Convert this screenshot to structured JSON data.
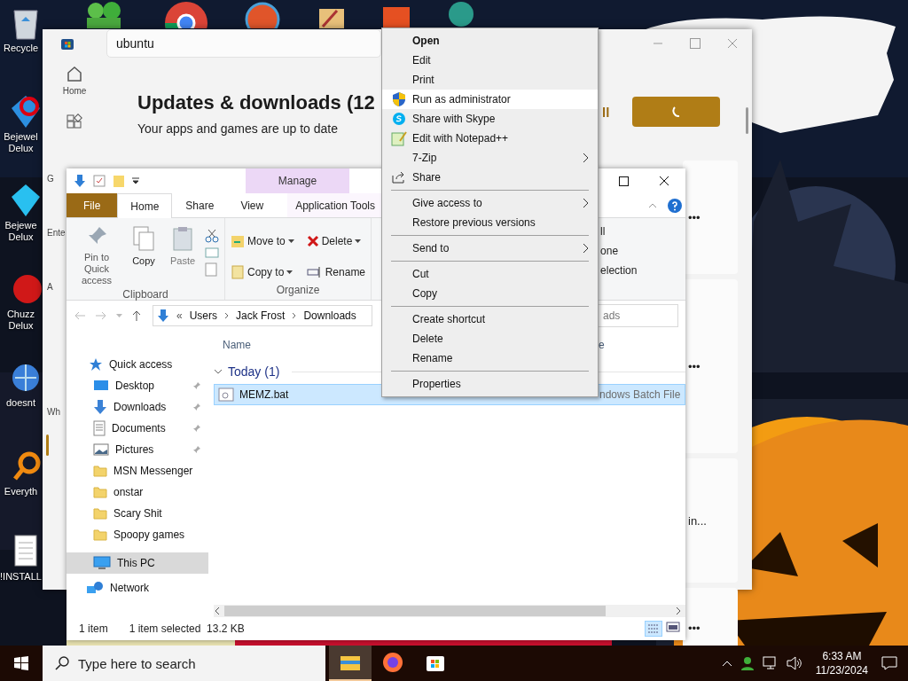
{
  "desktop": {
    "icons": [
      {
        "label": "Recycle"
      },
      {
        "label": "Bejewel Delux"
      },
      {
        "label": "Bejewe Delux"
      },
      {
        "label": "Chuzz Delux"
      },
      {
        "label": "doesnt"
      },
      {
        "label": "Everyth"
      },
      {
        "label": "!INSTALL"
      }
    ]
  },
  "store_window": {
    "search": {
      "value": "ubuntu"
    },
    "nav": [
      {
        "label": "Home"
      }
    ],
    "nav_fragments": [
      "G",
      "Ente",
      "A",
      "Wh"
    ],
    "heading": "Updates & downloads (12",
    "subtitle": "Your apps and games are up to date",
    "update_all_fragment": "ll",
    "card_fragments": [
      "•••",
      "•••",
      "in...",
      "•••"
    ]
  },
  "explorer_window": {
    "manage_label": "Manage",
    "tabs": [
      {
        "label": "File",
        "kind": "file",
        "selected": false
      },
      {
        "label": "Home",
        "kind": "tab",
        "selected": true
      },
      {
        "label": "Share",
        "kind": "tab",
        "selected": false
      },
      {
        "label": "View",
        "kind": "tab",
        "selected": false
      },
      {
        "label": "Application Tools",
        "kind": "tab",
        "selected": false
      }
    ],
    "ribbon": {
      "clipboard": {
        "label": "Clipboard",
        "buttons": [
          "Pin to Quick access",
          "Copy",
          "Paste"
        ]
      },
      "organize": {
        "label": "Organize",
        "buttons": [
          "Move to",
          "Delete",
          "Copy to",
          "Rename"
        ]
      },
      "select_fragments": [
        "ll",
        "one",
        "election"
      ]
    },
    "address_overflow": "«",
    "address": [
      "Users",
      "Jack Frost",
      "Downloads"
    ],
    "search_fragment": "ads",
    "columns": [
      "Name",
      "e"
    ],
    "nav": [
      {
        "label": "Quick access",
        "kind": "header",
        "pinned": false,
        "selected": false
      },
      {
        "label": "Desktop",
        "kind": "desktop",
        "pinned": true,
        "selected": false
      },
      {
        "label": "Downloads",
        "kind": "downloads",
        "pinned": true,
        "selected": false
      },
      {
        "label": "Documents",
        "kind": "documents",
        "pinned": true,
        "selected": false
      },
      {
        "label": "Pictures",
        "kind": "pictures",
        "pinned": true,
        "selected": false
      },
      {
        "label": "MSN Messenger",
        "kind": "folder",
        "pinned": false,
        "selected": false
      },
      {
        "label": "onstar",
        "kind": "folder",
        "pinned": false,
        "selected": false
      },
      {
        "label": "Scary Shit",
        "kind": "folder",
        "pinned": false,
        "selected": false
      },
      {
        "label": "Spoopy games",
        "kind": "folder",
        "pinned": false,
        "selected": false
      },
      {
        "label": "This PC",
        "kind": "pc",
        "pinned": false,
        "selected": true
      },
      {
        "label": "Network",
        "kind": "network",
        "pinned": false,
        "selected": false
      }
    ],
    "group": "Today (1)",
    "files": [
      {
        "name": "MEMZ.bat",
        "type": "ndows Batch File",
        "selected": true
      }
    ],
    "status": {
      "count": "1 item",
      "selection": "1 item selected",
      "size": "13.2 KB"
    }
  },
  "context_menu": [
    {
      "kind": "item",
      "label": "Open",
      "default": true,
      "selected": false,
      "submenu": false
    },
    {
      "kind": "item",
      "label": "Edit",
      "default": false,
      "selected": false,
      "submenu": false
    },
    {
      "kind": "item",
      "label": "Print",
      "default": false,
      "selected": false,
      "submenu": false
    },
    {
      "kind": "item",
      "label": "Run as administrator",
      "default": false,
      "selected": true,
      "submenu": false
    },
    {
      "kind": "item",
      "label": "Share with Skype",
      "default": false,
      "selected": false,
      "submenu": false
    },
    {
      "kind": "item",
      "label": "Edit with Notepad++",
      "default": false,
      "selected": false,
      "submenu": false
    },
    {
      "kind": "item",
      "label": "7-Zip",
      "default": false,
      "selected": false,
      "submenu": true
    },
    {
      "kind": "item",
      "label": "Share",
      "default": false,
      "selected": false,
      "submenu": false
    },
    {
      "kind": "separator"
    },
    {
      "kind": "item",
      "label": "Give access to",
      "default": false,
      "selected": false,
      "submenu": true
    },
    {
      "kind": "item",
      "label": "Restore previous versions",
      "default": false,
      "selected": false,
      "submenu": false
    },
    {
      "kind": "separator"
    },
    {
      "kind": "item",
      "label": "Send to",
      "default": false,
      "selected": false,
      "submenu": true
    },
    {
      "kind": "separator"
    },
    {
      "kind": "item",
      "label": "Cut",
      "default": false,
      "selected": false,
      "submenu": false
    },
    {
      "kind": "item",
      "label": "Copy",
      "default": false,
      "selected": false,
      "submenu": false
    },
    {
      "kind": "separator"
    },
    {
      "kind": "item",
      "label": "Create shortcut",
      "default": false,
      "selected": false,
      "submenu": false
    },
    {
      "kind": "item",
      "label": "Delete",
      "default": false,
      "selected": false,
      "submenu": false
    },
    {
      "kind": "item",
      "label": "Rename",
      "default": false,
      "selected": false,
      "submenu": false
    },
    {
      "kind": "separator"
    },
    {
      "kind": "item",
      "label": "Properties",
      "default": false,
      "selected": false,
      "submenu": false
    }
  ],
  "taskbar": {
    "search": {
      "placeholder": "Type here to search"
    },
    "apps": [
      {
        "kind": "explorer",
        "selected": true
      },
      {
        "kind": "firefox",
        "selected": false
      },
      {
        "kind": "store",
        "selected": false
      }
    ],
    "time": "6:33 AM",
    "date": "11/23/2024"
  }
}
